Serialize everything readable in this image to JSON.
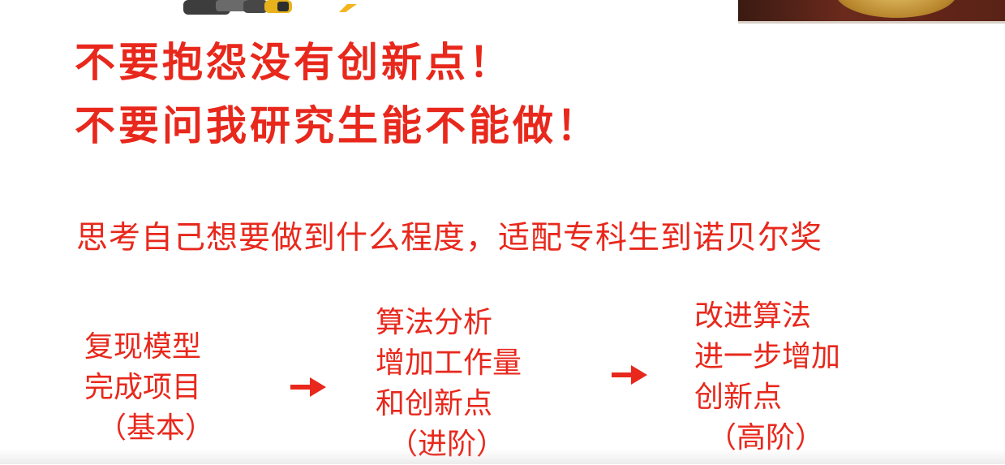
{
  "slide": {
    "headline_1": "不要抱怨没有创新点！",
    "headline_2": "不要问我研究生能不能做！",
    "subtitle": "思考自己想要做到什么程度，适配专科生到诺贝尔奖",
    "stages": [
      {
        "lines": [
          "复现模型",
          "完成项目"
        ],
        "level": "（基本）"
      },
      {
        "lines": [
          "算法分析",
          "增加工作量",
          "和创新点"
        ],
        "level": "（进阶）"
      },
      {
        "lines": [
          "改进算法",
          "进一步增加",
          "创新点"
        ],
        "level": "（高阶）"
      }
    ],
    "accent_color": "#e8281c",
    "arrow_icon": "right-arrow-icon"
  }
}
